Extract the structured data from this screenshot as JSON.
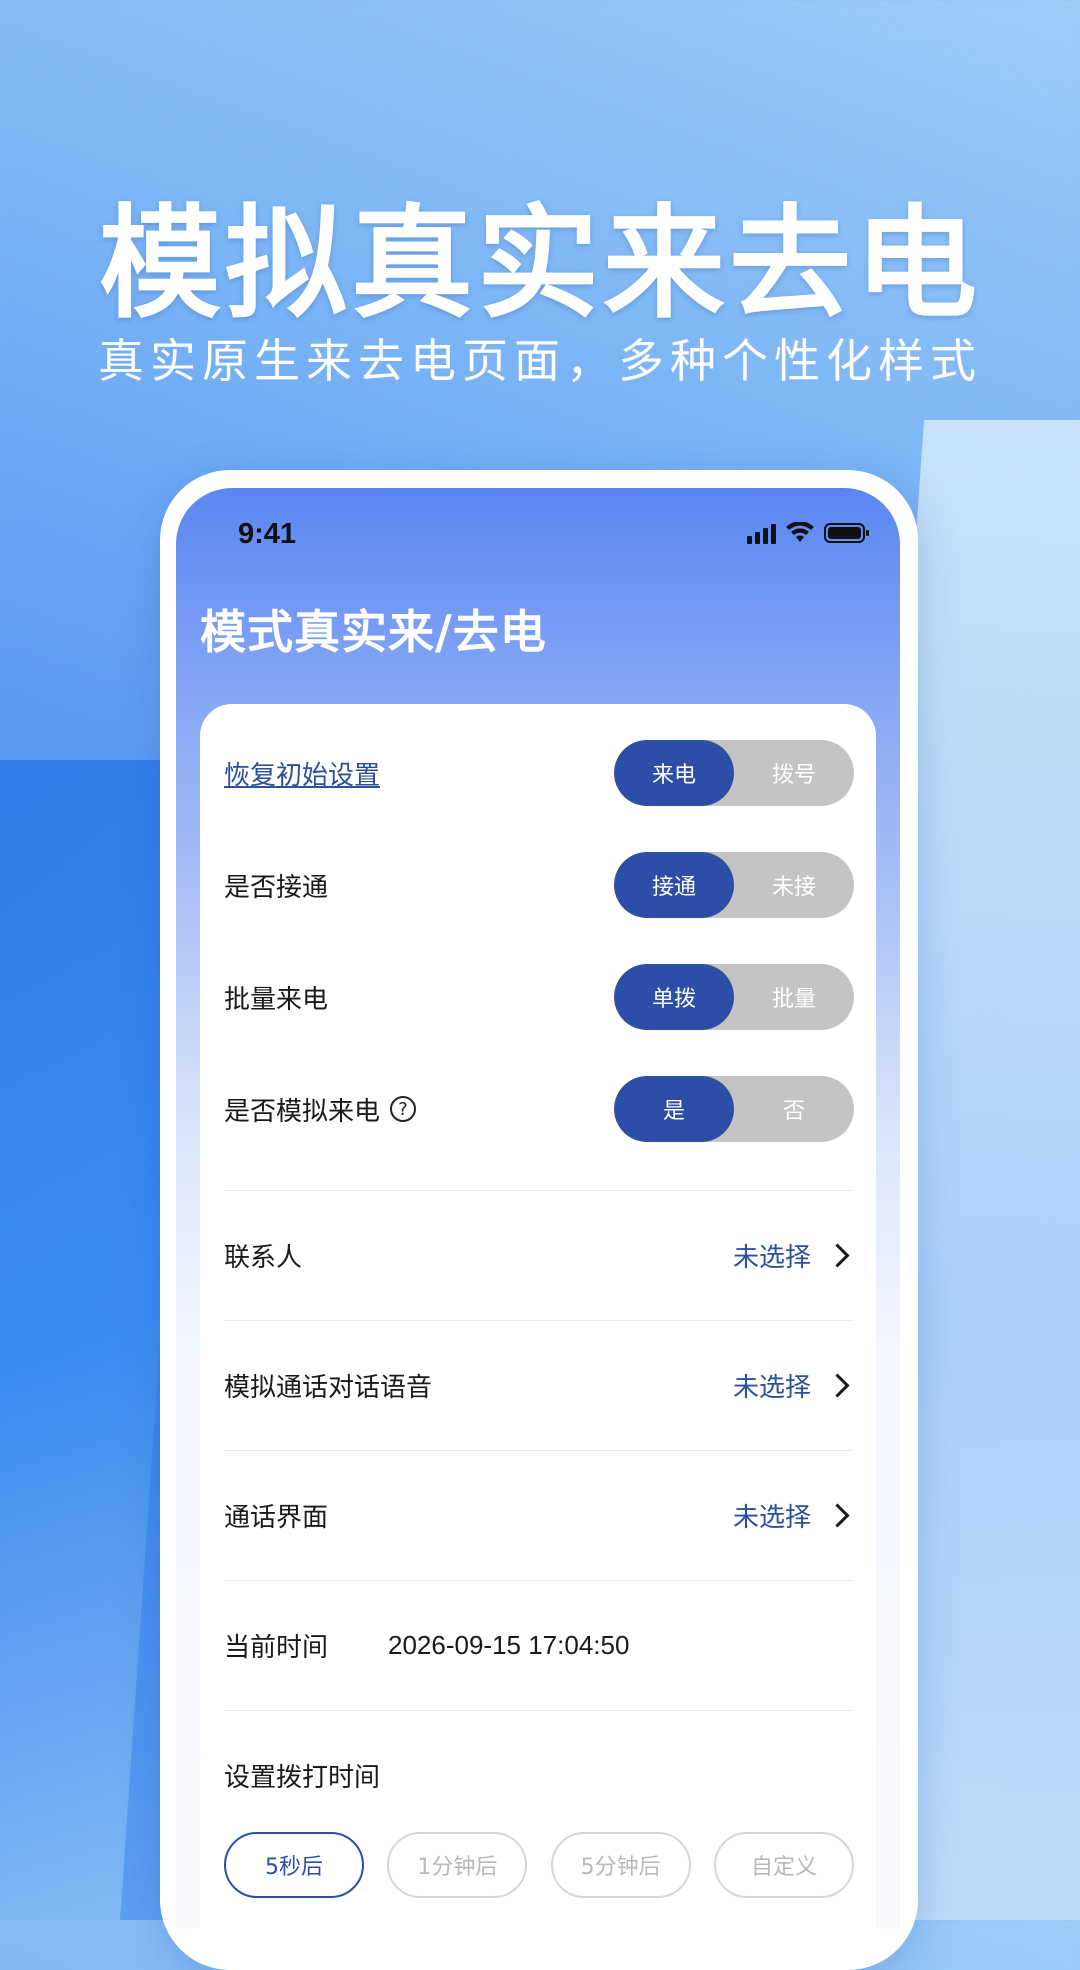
{
  "promo": {
    "headline": "模拟真实来去电",
    "subline": "真实原生来去电页面，多种个性化样式"
  },
  "status_bar": {
    "time": "9:41",
    "icons": [
      "cellular-signal-icon",
      "wifi-icon",
      "battery-icon"
    ]
  },
  "page": {
    "title": "模式真实来/去电"
  },
  "toggles": [
    {
      "label": "恢复初始设置",
      "is_link": true,
      "options": [
        "来电",
        "拨号"
      ],
      "selected": "来电"
    },
    {
      "label": "是否接通",
      "options": [
        "接通",
        "未接"
      ],
      "selected": "接通"
    },
    {
      "label": "批量来电",
      "options": [
        "单拨",
        "批量"
      ],
      "selected": "单拨"
    },
    {
      "label": "是否模拟来电",
      "has_help": true,
      "options": [
        "是",
        "否"
      ],
      "selected": "是"
    }
  ],
  "selectors": [
    {
      "label": "联系人",
      "value": "未选择"
    },
    {
      "label": "模拟通话对话语音",
      "value": "未选择"
    },
    {
      "label": "通话界面",
      "value": "未选择"
    }
  ],
  "current_time": {
    "label": "当前时间",
    "value": "2026-09-15 17:04:50"
  },
  "dial_time": {
    "label": "设置拨打时间",
    "options": [
      "5秒后",
      "1分钟后",
      "5分钟后",
      "自定义"
    ],
    "selected": "5秒后"
  },
  "colors": {
    "accent": "#2c4ea6",
    "toggle_off": "#c4c4c4",
    "link": "#2d4f9e"
  }
}
